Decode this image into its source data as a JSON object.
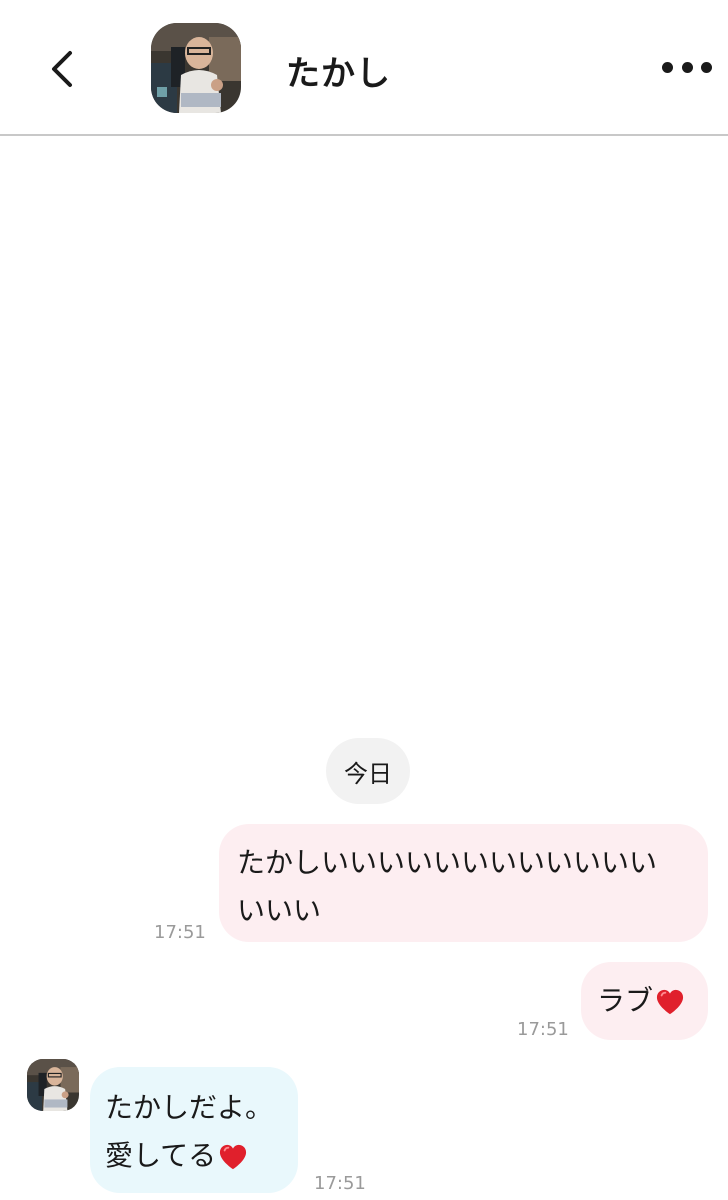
{
  "header": {
    "title": "たかし",
    "back_icon": "chevron-left-icon",
    "more_icon": "more-horizontal-icon"
  },
  "date_separator": "今日",
  "messages": [
    {
      "sender": "me",
      "text_line1": "たかしいいいいいいいいいいいい",
      "text_line2": "いいい",
      "time": "17:51"
    },
    {
      "sender": "me",
      "text": "ラブ",
      "emoji": "heart-icon",
      "time": "17:51"
    },
    {
      "sender": "たかし",
      "text_line1": "たかしだよ。",
      "text_line2": "愛してる",
      "emoji": "heart-icon",
      "time": "17:51"
    }
  ],
  "colors": {
    "my_bubble": "#fdeef1",
    "their_bubble": "#e9f8fc",
    "heart": "#e0202c",
    "divider": "#c8c8c8"
  }
}
